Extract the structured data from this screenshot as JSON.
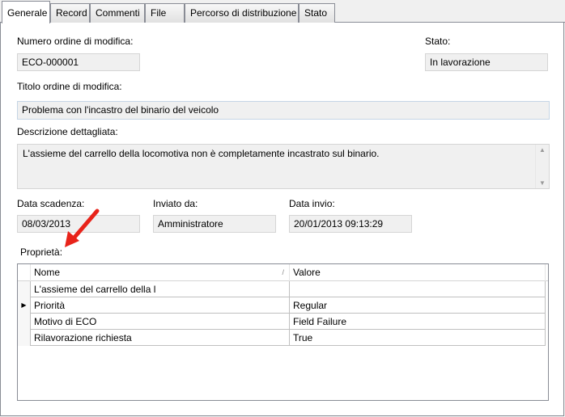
{
  "tabs": [
    {
      "label": "Generale"
    },
    {
      "label": "Record"
    },
    {
      "label": "Commenti"
    },
    {
      "label": "File"
    },
    {
      "label": "Percorso di distribuzione"
    },
    {
      "label": "Stato"
    }
  ],
  "form": {
    "numero_label": "Numero ordine di modifica:",
    "numero_value": "ECO-000001",
    "stato_label": "Stato:",
    "stato_value": "In lavorazione",
    "titolo_label": "Titolo ordine di modifica:",
    "titolo_value": "Problema con l'incastro del binario del veicolo",
    "descrizione_label": "Descrizione dettagliata:",
    "descrizione_value": "L'assieme del carrello della locomotiva non è completamente incastrato sul binario.",
    "scadenza_label": "Data scadenza:",
    "scadenza_value": "08/03/2013",
    "inviato_label": "Inviato da:",
    "inviato_value": "Amministratore",
    "invio_label": "Data invio:",
    "invio_value": "20/01/2013 09:13:29",
    "proprieta_label": "Proprietà:"
  },
  "grid": {
    "columns": [
      "Nome",
      "Valore"
    ],
    "sort_glyph": "/",
    "rows": [
      {
        "nome": "L'assieme del carrello della l",
        "valore": "",
        "current": false
      },
      {
        "nome": "Priorità",
        "valore": "Regular",
        "current": true
      },
      {
        "nome": "Motivo di ECO",
        "valore": "Field Failure",
        "current": false
      },
      {
        "nome": "Rilavorazione richiesta",
        "valore": "True",
        "current": false
      }
    ]
  },
  "colors": {
    "arrow": "#e8231a",
    "field_bg": "#f0f0f0",
    "border": "#898c95"
  }
}
